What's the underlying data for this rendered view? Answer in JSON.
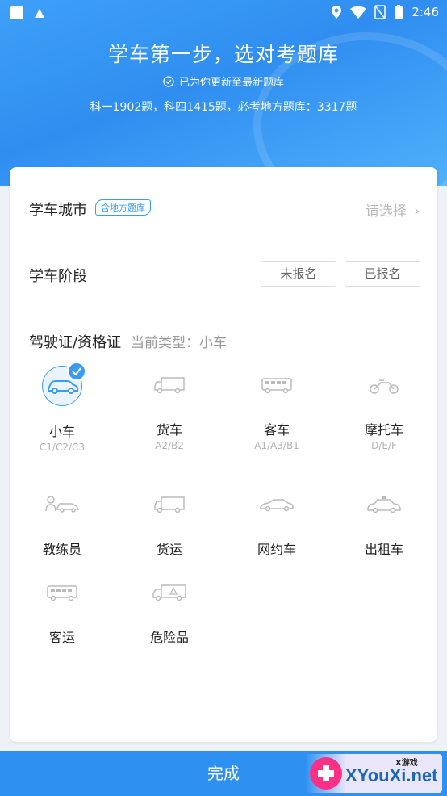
{
  "status_bar": {
    "time": "2:46"
  },
  "hero": {
    "title": "学车第一步，选对考题库",
    "subtitle": "已为你更新至最新题库",
    "counts": "科一1902题，科四1415题，必考地方题库：3317题"
  },
  "city": {
    "label": "学车城市",
    "badge": "含地方题库",
    "placeholder": "请选择",
    "chevron": "›"
  },
  "stage": {
    "label": "学车阶段",
    "options": [
      "未报名",
      "已报名"
    ]
  },
  "license": {
    "label": "驾驶证/资格证",
    "current_type": "当前类型：小车"
  },
  "types": [
    {
      "name": "小车",
      "code": "C1/C2/C3",
      "icon": "car-icon",
      "selected": true
    },
    {
      "name": "货车",
      "code": "A2/B2",
      "icon": "truck-icon"
    },
    {
      "name": "客车",
      "code": "A1/A3/B1",
      "icon": "bus-icon"
    },
    {
      "name": "摩托车",
      "code": "D/E/F",
      "icon": "motorcycle-icon"
    },
    {
      "name": "教练员",
      "code": "",
      "icon": "coach-icon"
    },
    {
      "name": "货运",
      "code": "",
      "icon": "freight-truck-icon"
    },
    {
      "name": "网约车",
      "code": "",
      "icon": "ride-hailing-car-icon"
    },
    {
      "name": "出租车",
      "code": "",
      "icon": "taxi-icon"
    },
    {
      "name": "客运",
      "code": "",
      "icon": "passenger-bus-icon"
    },
    {
      "name": "危险品",
      "code": "",
      "icon": "hazmat-truck-icon"
    }
  ],
  "footer": {
    "done": "完成"
  },
  "watermark": {
    "top": "X游戏",
    "main": "XYouXi.net"
  },
  "colors": {
    "accent": "#2e90f1",
    "hero": "#3ea0f7"
  }
}
